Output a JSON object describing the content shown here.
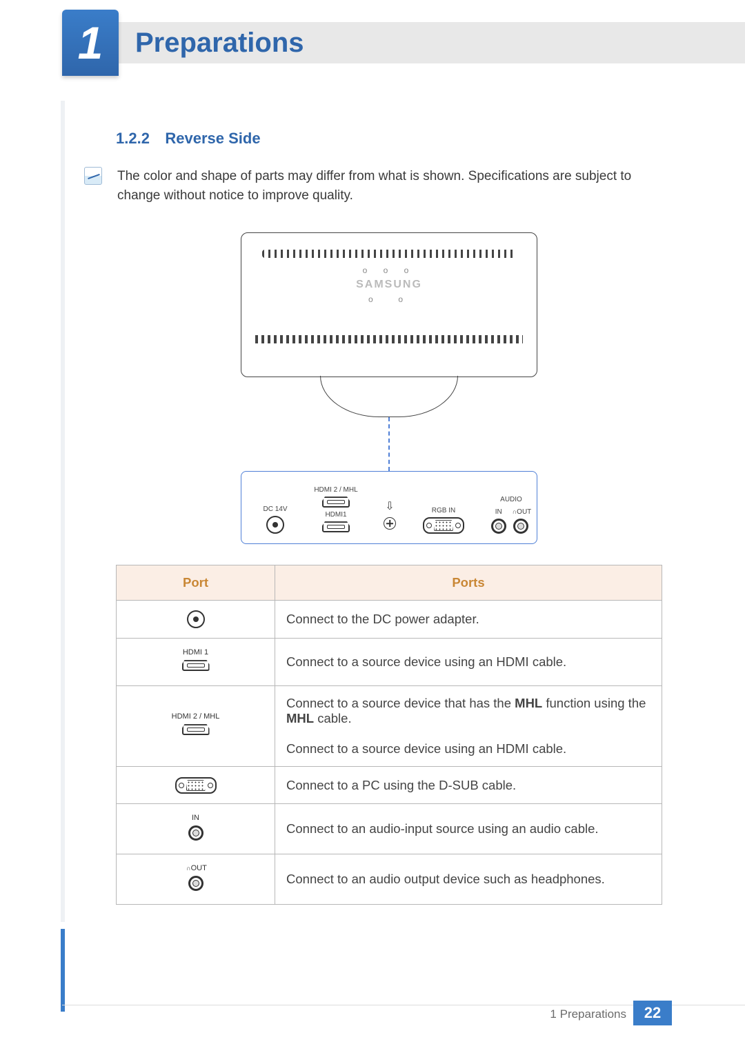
{
  "header": {
    "chapter_number": "1",
    "chapter_title": "Preparations"
  },
  "section": {
    "number": "1.2.2",
    "title": "Reverse Side"
  },
  "note": {
    "text": "The color and shape of parts may differ from what is shown. Specifications are subject to change without notice to improve quality."
  },
  "figure": {
    "brand": "SAMSUNG",
    "panel": {
      "dc_label": "DC 14V",
      "hdmi2_label": "HDMI 2 / MHL",
      "hdmi1_label": "HDMI1",
      "rgb_label": "RGB IN",
      "audio_group": "AUDIO",
      "audio_in": "IN",
      "audio_out": "OUT"
    }
  },
  "table": {
    "headers": {
      "port": "Port",
      "desc": "Ports"
    },
    "rows": [
      {
        "icon_label": "",
        "desc_html": "Connect to the DC power adapter."
      },
      {
        "icon_label": "HDMI 1",
        "desc_html": "Connect to a source device using an HDMI cable."
      },
      {
        "icon_label": "HDMI 2 / MHL",
        "desc_html": "Connect to a source device that has the <b>MHL</b> function using the <b>MHL</b> cable.<br><br>Connect to a source device using an HDMI cable."
      },
      {
        "icon_label": "",
        "desc_html": "Connect to a PC using the D-SUB cable."
      },
      {
        "icon_label": "IN",
        "desc_html": "Connect to an audio-input source using an audio cable."
      },
      {
        "icon_label": "OUT",
        "desc_html": "Connect to an audio output device such as headphones."
      }
    ]
  },
  "footer": {
    "label": "1 Preparations",
    "page": "22"
  }
}
